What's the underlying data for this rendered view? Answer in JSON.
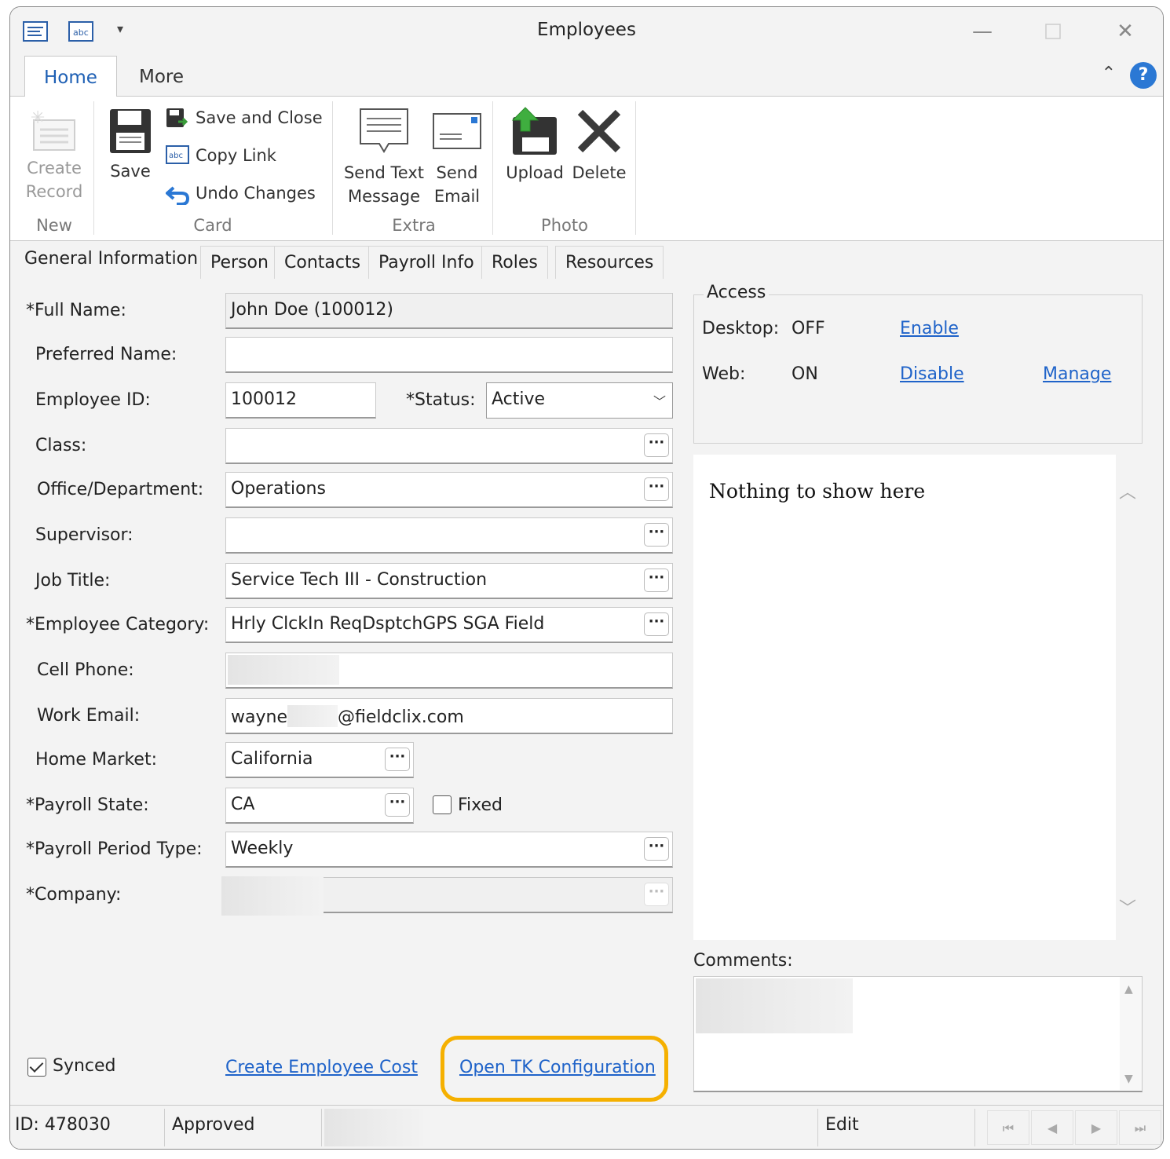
{
  "window": {
    "title": "Employees"
  },
  "ribbon": {
    "tabs": [
      "Home",
      "More"
    ],
    "groups": {
      "new": {
        "label": "New",
        "create_record": "Create Record"
      },
      "card": {
        "label": "Card",
        "save": "Save",
        "save_and_close": "Save and Close",
        "copy_link": "Copy Link",
        "undo_changes": "Undo Changes"
      },
      "extra": {
        "label": "Extra",
        "send_text_message": "Send Text Message",
        "send_email": "Send Email"
      },
      "photo": {
        "label": "Photo",
        "upload": "Upload",
        "delete": "Delete"
      }
    }
  },
  "detail_tabs": [
    "General Information",
    "Person",
    "Contacts",
    "Payroll Info",
    "Roles",
    "Resources"
  ],
  "form": {
    "full_name": {
      "label": "*Full Name:",
      "value": "John Doe (100012)"
    },
    "preferred_name": {
      "label": "Preferred Name:",
      "value": ""
    },
    "employee_id": {
      "label": "Employee ID:",
      "value": "100012"
    },
    "status": {
      "label": "*Status:",
      "value": "Active"
    },
    "class": {
      "label": "Class:",
      "value": ""
    },
    "office_department": {
      "label": "Office/Department:",
      "value": "Operations"
    },
    "supervisor": {
      "label": "Supervisor:",
      "value": ""
    },
    "job_title": {
      "label": "Job Title:",
      "value": "Service Tech III - Construction"
    },
    "employee_category": {
      "label": "*Employee Category:",
      "value": "Hrly ClckIn ReqDsptchGPS SGA Field"
    },
    "cell_phone": {
      "label": "Cell Phone:",
      "value": ""
    },
    "work_email": {
      "label": "Work Email:",
      "value_start": "wayne",
      "value_end": "@fieldclix.com"
    },
    "home_market": {
      "label": "Home Market:",
      "value": "California"
    },
    "payroll_state": {
      "label": "*Payroll State:",
      "value": "CA",
      "fixed_label": "Fixed",
      "fixed_checked": false
    },
    "payroll_period_type": {
      "label": "*Payroll Period Type:",
      "value": "Weekly"
    },
    "company": {
      "label": "*Company:",
      "value": ""
    }
  },
  "access": {
    "title": "Access",
    "desktop": {
      "label": "Desktop:",
      "state": "OFF",
      "action": "Enable"
    },
    "web": {
      "label": "Web:",
      "state": "ON",
      "action": "Disable",
      "manage": "Manage"
    }
  },
  "side_panel": {
    "empty_text": "Nothing to show here"
  },
  "comments": {
    "label": "Comments:"
  },
  "footer": {
    "synced_label": "Synced",
    "synced_checked": true,
    "create_employee_cost": "Create Employee Cost",
    "open_tk_configuration": "Open TK Configuration"
  },
  "statusbar": {
    "id": "ID: 478030",
    "state": "Approved",
    "mode": "Edit"
  },
  "colors": {
    "link": "#1f63c9",
    "highlight": "#f5b000",
    "accent": "#1d5fb4"
  }
}
